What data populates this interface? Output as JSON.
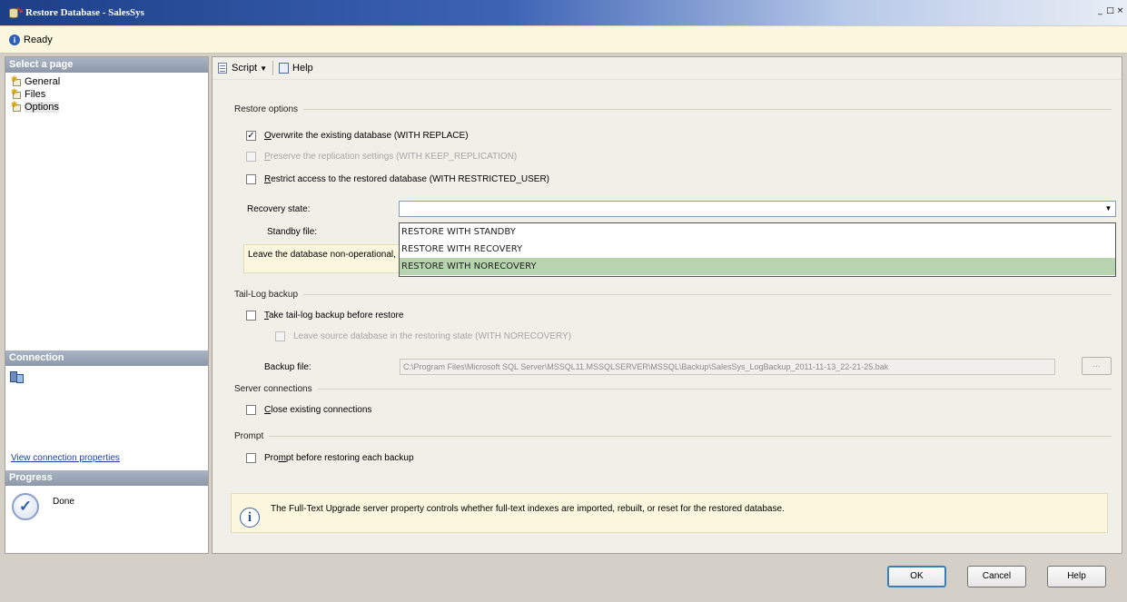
{
  "window": {
    "title": "Restore Database - SalesSys"
  },
  "status": {
    "text": "Ready"
  },
  "left": {
    "select_page_header": "Select a page",
    "pages": [
      {
        "label": "General"
      },
      {
        "label": "Files"
      },
      {
        "label": "Options"
      }
    ],
    "connection_header": "Connection",
    "view_connection_link": "View connection properties",
    "progress_header": "Progress",
    "progress_status": "Done"
  },
  "toolbar": {
    "script_label": "Script",
    "help_label": "Help"
  },
  "restore_options": {
    "header": "Restore options",
    "overwrite": {
      "label_u": "O",
      "label_rest": "verwrite the existing database (WITH REPLACE)",
      "checked": true
    },
    "preserve": {
      "label_u": "P",
      "label_rest": "reserve the replication settings (WITH KEEP_REPLICATION)",
      "checked": false,
      "disabled": true
    },
    "restrict": {
      "label_u": "R",
      "label_rest": "estrict access to the restored database (WITH RESTRICTED_USER)",
      "checked": false
    },
    "recovery_state_label": "Recovery state:",
    "recovery_state_value": "",
    "recovery_options": [
      "RESTORE WITH STANDBY",
      "RESTORE WITH RECOVERY",
      "RESTORE WITH NORECOVERY"
    ],
    "recovery_selected_index": 2,
    "standby_file_label": "Standby file:",
    "recovery_note": "Leave the database non-operational, and do not roll back uncommitted transactions. Additional transaction logs can be restored."
  },
  "tail_log": {
    "header": "Tail-Log backup",
    "take_backup": {
      "label_u": "T",
      "label_rest": "ake tail-log backup before restore",
      "checked": false
    },
    "leave_source": {
      "label": "Leave source database in the restoring state (WITH NORECOVERY)",
      "checked": false,
      "disabled": true
    },
    "backup_file_label": "Backup file:",
    "backup_file_value": "C:\\Program Files\\Microsoft SQL Server\\MSSQL11.MSSQLSERVER\\MSSQL\\Backup\\SalesSys_LogBackup_2011-11-13_22-21-25.bak",
    "browse_label": "..."
  },
  "server_connections": {
    "header": "Server connections",
    "close_existing": {
      "label_u": "C",
      "label_rest": "lose existing connections",
      "checked": false
    }
  },
  "prompt": {
    "header": "Prompt",
    "prompt_before": {
      "label_pre": "Pro",
      "label_u": "m",
      "label_rest": "pt before restoring each backup",
      "checked": false
    }
  },
  "info_banner": {
    "text": "The Full-Text Upgrade server property controls whether full-text indexes are imported, rebuilt, or reset for the restored database."
  },
  "buttons": {
    "ok": "OK",
    "cancel": "Cancel",
    "help": "Help"
  },
  "colors": {
    "selected_dropdown_item": "#b8d3b0",
    "note_background": "#fbf6de",
    "title_bar": "#1c3f87"
  }
}
